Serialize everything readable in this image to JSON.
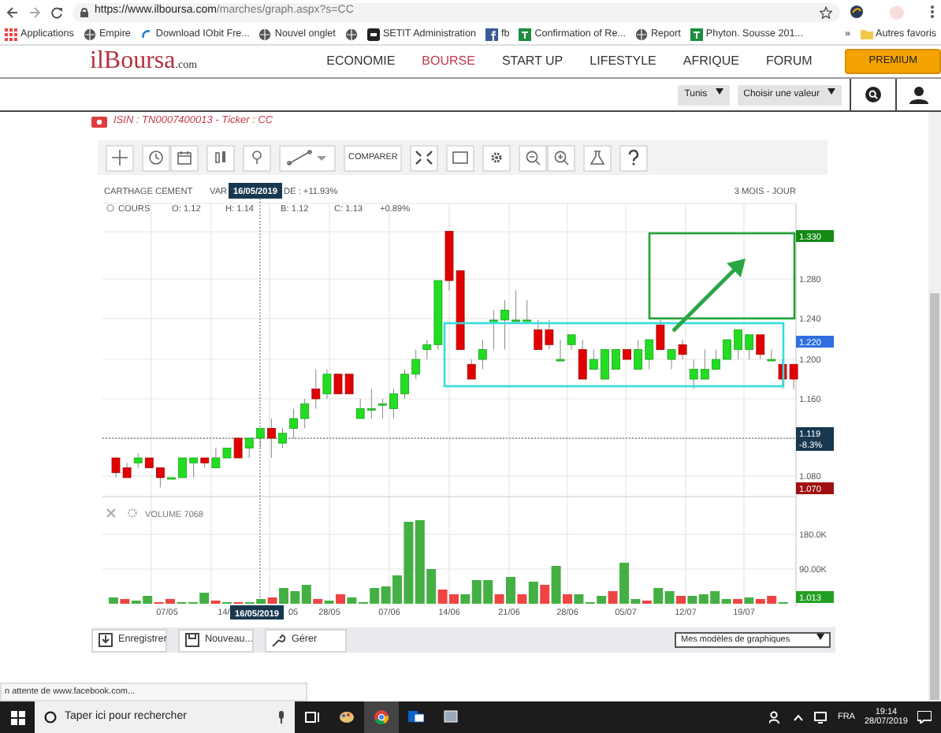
{
  "browser": {
    "url_host": "https://www.ilboursa.com",
    "url_path": "/marches/graph.aspx?s=CC",
    "bookmarks": [
      {
        "kind": "apps",
        "label": "Applications"
      },
      {
        "kind": "globe",
        "label": "Empire"
      },
      {
        "kind": "swirl",
        "label": "Download IObit Fre..."
      },
      {
        "kind": "globe",
        "label": "Nouvel onglet"
      },
      {
        "kind": "globe"
      },
      {
        "kind": "dark",
        "label": "SETIT Administration"
      },
      {
        "kind": "fb",
        "label": "fb"
      },
      {
        "kind": "sheet",
        "label": "Confirmation of Re..."
      },
      {
        "kind": "globe",
        "label": "Report"
      },
      {
        "kind": "sheet",
        "label": "Phyton. Sousse 201..."
      }
    ],
    "more": "»",
    "other_bookmarks": "Autres favoris"
  },
  "site": {
    "logo": "ilBoursa",
    "logo_suffix": ".com",
    "nav": [
      {
        "label": "ECONOMIE",
        "selected": false
      },
      {
        "label": "BOURSE",
        "selected": true
      },
      {
        "label": "START UP",
        "selected": false
      },
      {
        "label": "LIFESTYLE",
        "selected": false
      },
      {
        "label": "AFRIQUE",
        "selected": false
      },
      {
        "label": "FORUM",
        "selected": false
      }
    ],
    "premium": "PREMIUM",
    "market_select": "Tunis",
    "value_select": "Choisir une valeur"
  },
  "isin": "ISIN : TN0007400013 - Ticker : CC",
  "toolbar": {
    "compare": "COMPARER"
  },
  "chart": {
    "name": "CARTHAGE CEMENT",
    "variation_start": "VAR",
    "variation_end": "DE : +11.93%",
    "period": "3 MOIS - JOUR",
    "cursor_date": "16/05/2019",
    "series_label": "COURS",
    "ohlc": [
      "O: 1.12",
      "H: 1.14",
      "B: 1.12",
      "C: 1.13",
      "+0.89%"
    ],
    "price_ticks": [
      "1.280",
      "1.240",
      "1.200",
      "1.160",
      "1.080"
    ],
    "badges": [
      {
        "kind": "high",
        "value": "1.330"
      },
      {
        "kind": "last",
        "value": "1.220"
      },
      {
        "kind": "cursor",
        "value": "1.119",
        "change": "-8.3%"
      },
      {
        "kind": "low",
        "value": "1.070"
      }
    ],
    "volume_label": "VOLUME 7068",
    "volume_ticks": [
      "180.0K",
      "90.00K"
    ],
    "volume_badge": "1.013",
    "x_labels": [
      "07/05",
      "14/",
      "05",
      "28/05",
      "07/06",
      "14/06",
      "21/06",
      "28/06",
      "05/07",
      "12/07",
      "19/07"
    ],
    "bottom_date": "16/05/2019"
  },
  "actions": [
    "Enregistrer",
    "Nouveau...",
    "Gérer"
  ],
  "templates_select": "Mes modèles de graphiques",
  "status": "n attente de www.facebook.com...",
  "taskbar": {
    "search": "Taper ici pour rechercher",
    "language": "FRA",
    "time": "19:14",
    "date": "28/07/2019"
  }
}
